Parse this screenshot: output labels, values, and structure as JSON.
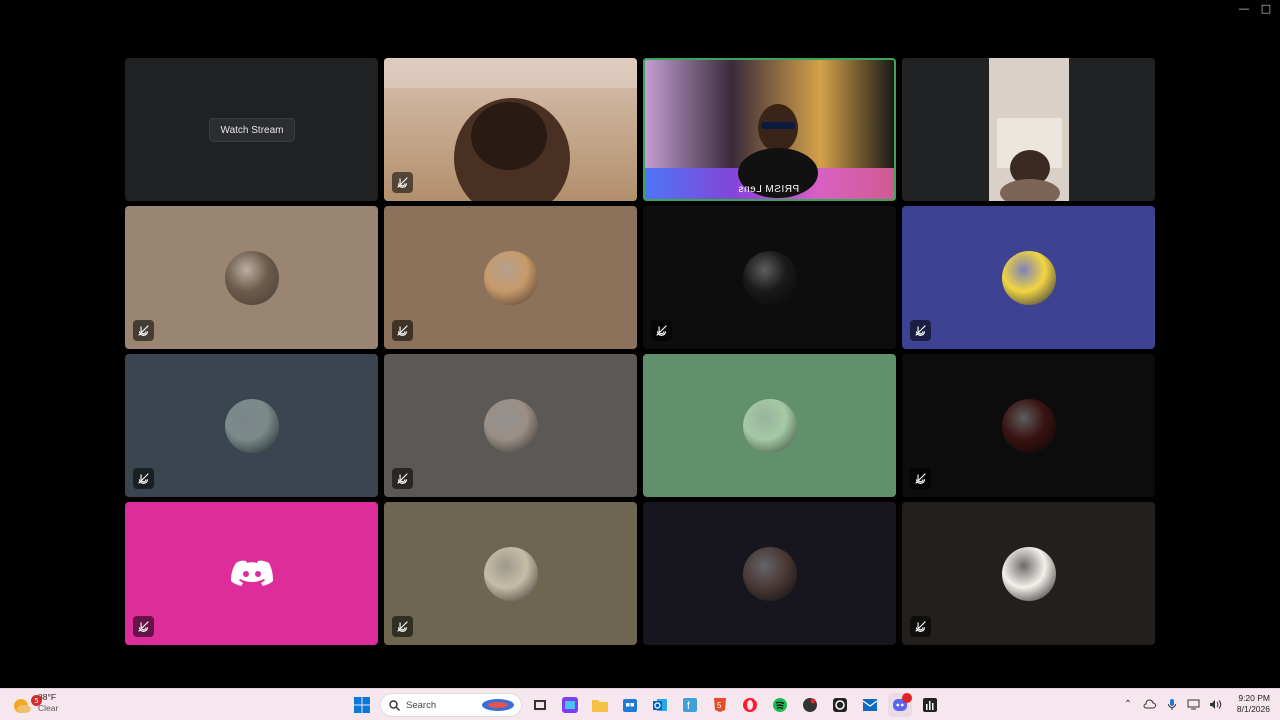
{
  "window": {
    "controls": [
      "minimize",
      "maximize"
    ]
  },
  "tiles": [
    {
      "type": "stream",
      "bg": "#1f2123",
      "button_label": "Watch Stream"
    },
    {
      "type": "video",
      "bg": "#b9a48f",
      "muted": true
    },
    {
      "type": "video",
      "bg": "#4a3f5a",
      "speaking": true,
      "label": "PRISM Lens"
    },
    {
      "type": "video",
      "bg": "#202223",
      "muted": false
    },
    {
      "type": "avatar",
      "bg": "#998571",
      "avatar_color": "#6d5b4b",
      "muted": true
    },
    {
      "type": "avatar",
      "bg": "#8c725a",
      "avatar_color": "#c89a6a",
      "muted": true
    },
    {
      "type": "avatar",
      "bg": "#0d0d0d",
      "avatar_color": "#1a1a1a",
      "muted": true
    },
    {
      "type": "avatar",
      "bg": "#3d4392",
      "avatar_color": "#f2d541",
      "muted": true
    },
    {
      "type": "avatar",
      "bg": "#3b4550",
      "avatar_color": "#7a8c8a",
      "muted": true
    },
    {
      "type": "avatar",
      "bg": "#5c5856",
      "avatar_color": "#9a8f86",
      "muted": true
    },
    {
      "type": "avatar",
      "bg": "#62906b",
      "avatar_color": "#a6c9a4",
      "muted": false
    },
    {
      "type": "avatar",
      "bg": "#0c0c0c",
      "avatar_color": "#3a1212",
      "muted": true
    },
    {
      "type": "discord",
      "bg": "#dd2d9a",
      "muted": true
    },
    {
      "type": "avatar",
      "bg": "#6e6650",
      "avatar_color": "#c6bda7",
      "muted": true
    },
    {
      "type": "avatar",
      "bg": "#17161f",
      "avatar_color": "#4a3a36",
      "muted": false
    },
    {
      "type": "avatar",
      "bg": "#231f1c",
      "avatar_color": "#f4f1ec",
      "muted": true
    }
  ],
  "taskbar": {
    "weather": {
      "temp": "88°F",
      "condition": "Clear",
      "badge": "5"
    },
    "search_placeholder": "Search",
    "clock": {
      "time": "9:20 PM",
      "date": "8/1/2026"
    },
    "icons": [
      "windows-start-icon",
      "search-icon",
      "task-view-icon",
      "news-icon",
      "file-explorer-icon",
      "store-icon",
      "outlook-icon",
      "app-f-icon",
      "html5-icon",
      "opera-icon",
      "spotify-icon",
      "media-icon",
      "obs-icon",
      "mail-icon",
      "discord-icon",
      "audio-app-icon"
    ],
    "tray_icons": [
      "chevron-up-icon",
      "cloud-icon",
      "microphone-icon",
      "display-icon",
      "volume-icon"
    ]
  }
}
